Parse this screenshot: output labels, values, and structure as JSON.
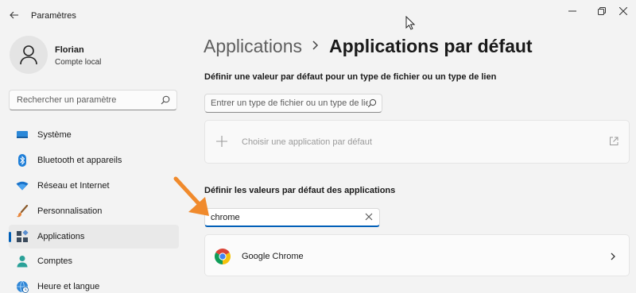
{
  "window": {
    "title": "Paramètres"
  },
  "user": {
    "name": "Florian",
    "account_type": "Compte local"
  },
  "sidebar": {
    "search_placeholder": "Rechercher un paramètre",
    "items": [
      {
        "label": "Système",
        "icon": "monitor-icon",
        "active": false
      },
      {
        "label": "Bluetooth et appareils",
        "icon": "bluetooth-icon",
        "active": false
      },
      {
        "label": "Réseau et Internet",
        "icon": "wifi-icon",
        "active": false
      },
      {
        "label": "Personnalisation",
        "icon": "brush-icon",
        "active": false
      },
      {
        "label": "Applications",
        "icon": "apps-icon",
        "active": true
      },
      {
        "label": "Comptes",
        "icon": "person-icon",
        "active": false
      },
      {
        "label": "Heure et langue",
        "icon": "globe-clock-icon",
        "active": false
      }
    ]
  },
  "main": {
    "breadcrumb_parent": "Applications",
    "breadcrumb_separator": "›",
    "title": "Applications par défaut",
    "filetype_section_heading": "Définir une valeur par défaut pour un type de fichier ou un type de lien",
    "filetype_input_placeholder": "Entrer un type de fichier ou un type de lien",
    "choose_app_label": "Choisir une application par défaut",
    "apps_section_heading": "Définir les valeurs par défaut des applications",
    "app_search_value": "chrome",
    "results": [
      {
        "label": "Google Chrome",
        "icon": "chrome-icon"
      }
    ]
  },
  "colors": {
    "accent": "#005fb8",
    "annotation_arrow": "#f08a2c",
    "background": "#f3f3f3"
  }
}
